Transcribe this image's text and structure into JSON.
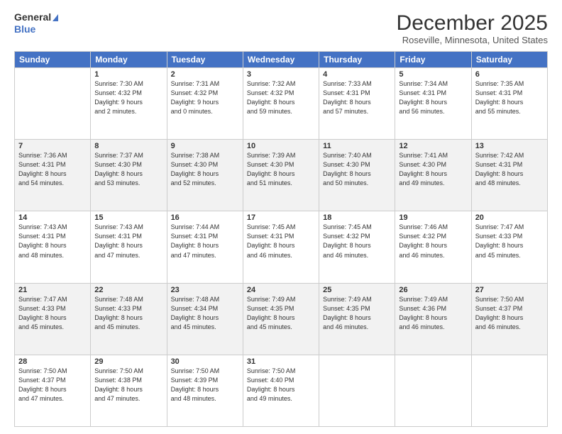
{
  "logo": {
    "line1": "General",
    "line2": "Blue"
  },
  "title": "December 2025",
  "location": "Roseville, Minnesota, United States",
  "days_header": [
    "Sunday",
    "Monday",
    "Tuesday",
    "Wednesday",
    "Thursday",
    "Friday",
    "Saturday"
  ],
  "weeks": [
    [
      {
        "day": "",
        "info": ""
      },
      {
        "day": "1",
        "info": "Sunrise: 7:30 AM\nSunset: 4:32 PM\nDaylight: 9 hours\nand 2 minutes."
      },
      {
        "day": "2",
        "info": "Sunrise: 7:31 AM\nSunset: 4:32 PM\nDaylight: 9 hours\nand 0 minutes."
      },
      {
        "day": "3",
        "info": "Sunrise: 7:32 AM\nSunset: 4:32 PM\nDaylight: 8 hours\nand 59 minutes."
      },
      {
        "day": "4",
        "info": "Sunrise: 7:33 AM\nSunset: 4:31 PM\nDaylight: 8 hours\nand 57 minutes."
      },
      {
        "day": "5",
        "info": "Sunrise: 7:34 AM\nSunset: 4:31 PM\nDaylight: 8 hours\nand 56 minutes."
      },
      {
        "day": "6",
        "info": "Sunrise: 7:35 AM\nSunset: 4:31 PM\nDaylight: 8 hours\nand 55 minutes."
      }
    ],
    [
      {
        "day": "7",
        "info": "Sunrise: 7:36 AM\nSunset: 4:31 PM\nDaylight: 8 hours\nand 54 minutes."
      },
      {
        "day": "8",
        "info": "Sunrise: 7:37 AM\nSunset: 4:30 PM\nDaylight: 8 hours\nand 53 minutes."
      },
      {
        "day": "9",
        "info": "Sunrise: 7:38 AM\nSunset: 4:30 PM\nDaylight: 8 hours\nand 52 minutes."
      },
      {
        "day": "10",
        "info": "Sunrise: 7:39 AM\nSunset: 4:30 PM\nDaylight: 8 hours\nand 51 minutes."
      },
      {
        "day": "11",
        "info": "Sunrise: 7:40 AM\nSunset: 4:30 PM\nDaylight: 8 hours\nand 50 minutes."
      },
      {
        "day": "12",
        "info": "Sunrise: 7:41 AM\nSunset: 4:30 PM\nDaylight: 8 hours\nand 49 minutes."
      },
      {
        "day": "13",
        "info": "Sunrise: 7:42 AM\nSunset: 4:31 PM\nDaylight: 8 hours\nand 48 minutes."
      }
    ],
    [
      {
        "day": "14",
        "info": "Sunrise: 7:43 AM\nSunset: 4:31 PM\nDaylight: 8 hours\nand 48 minutes."
      },
      {
        "day": "15",
        "info": "Sunrise: 7:43 AM\nSunset: 4:31 PM\nDaylight: 8 hours\nand 47 minutes."
      },
      {
        "day": "16",
        "info": "Sunrise: 7:44 AM\nSunset: 4:31 PM\nDaylight: 8 hours\nand 47 minutes."
      },
      {
        "day": "17",
        "info": "Sunrise: 7:45 AM\nSunset: 4:31 PM\nDaylight: 8 hours\nand 46 minutes."
      },
      {
        "day": "18",
        "info": "Sunrise: 7:45 AM\nSunset: 4:32 PM\nDaylight: 8 hours\nand 46 minutes."
      },
      {
        "day": "19",
        "info": "Sunrise: 7:46 AM\nSunset: 4:32 PM\nDaylight: 8 hours\nand 46 minutes."
      },
      {
        "day": "20",
        "info": "Sunrise: 7:47 AM\nSunset: 4:33 PM\nDaylight: 8 hours\nand 45 minutes."
      }
    ],
    [
      {
        "day": "21",
        "info": "Sunrise: 7:47 AM\nSunset: 4:33 PM\nDaylight: 8 hours\nand 45 minutes."
      },
      {
        "day": "22",
        "info": "Sunrise: 7:48 AM\nSunset: 4:33 PM\nDaylight: 8 hours\nand 45 minutes."
      },
      {
        "day": "23",
        "info": "Sunrise: 7:48 AM\nSunset: 4:34 PM\nDaylight: 8 hours\nand 45 minutes."
      },
      {
        "day": "24",
        "info": "Sunrise: 7:49 AM\nSunset: 4:35 PM\nDaylight: 8 hours\nand 45 minutes."
      },
      {
        "day": "25",
        "info": "Sunrise: 7:49 AM\nSunset: 4:35 PM\nDaylight: 8 hours\nand 46 minutes."
      },
      {
        "day": "26",
        "info": "Sunrise: 7:49 AM\nSunset: 4:36 PM\nDaylight: 8 hours\nand 46 minutes."
      },
      {
        "day": "27",
        "info": "Sunrise: 7:50 AM\nSunset: 4:37 PM\nDaylight: 8 hours\nand 46 minutes."
      }
    ],
    [
      {
        "day": "28",
        "info": "Sunrise: 7:50 AM\nSunset: 4:37 PM\nDaylight: 8 hours\nand 47 minutes."
      },
      {
        "day": "29",
        "info": "Sunrise: 7:50 AM\nSunset: 4:38 PM\nDaylight: 8 hours\nand 47 minutes."
      },
      {
        "day": "30",
        "info": "Sunrise: 7:50 AM\nSunset: 4:39 PM\nDaylight: 8 hours\nand 48 minutes."
      },
      {
        "day": "31",
        "info": "Sunrise: 7:50 AM\nSunset: 4:40 PM\nDaylight: 8 hours\nand 49 minutes."
      },
      {
        "day": "",
        "info": ""
      },
      {
        "day": "",
        "info": ""
      },
      {
        "day": "",
        "info": ""
      }
    ]
  ]
}
